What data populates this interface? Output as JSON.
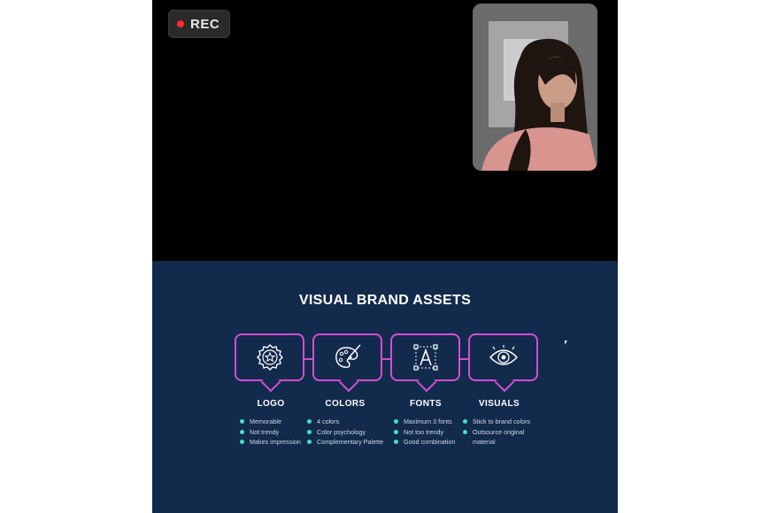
{
  "recording": {
    "label": "REC",
    "dot_color": "#ff2a2a"
  },
  "slide": {
    "title": "VISUAL BRAND ASSETS",
    "accent_color": "#d24fd4",
    "bullet_color": "#3fe0d0",
    "background": "#122a4b",
    "columns": [
      {
        "title": "LOGO",
        "icon": "badge-star-icon",
        "bullets": [
          "Memorable",
          "Not trendy",
          "Makes impression"
        ]
      },
      {
        "title": "COLORS",
        "icon": "palette-brush-icon",
        "bullets": [
          "4 colors",
          "Color psychology",
          "Complementary Palette"
        ]
      },
      {
        "title": "FONTS",
        "icon": "font-letter-a-icon",
        "bullets": [
          "Maximum 3 fonts",
          "Not too trendy",
          "Good combination"
        ]
      },
      {
        "title": "VISUALS",
        "icon": "eye-icon",
        "bullets": [
          "Stick to brand colors",
          "Outsource original material"
        ]
      }
    ]
  }
}
